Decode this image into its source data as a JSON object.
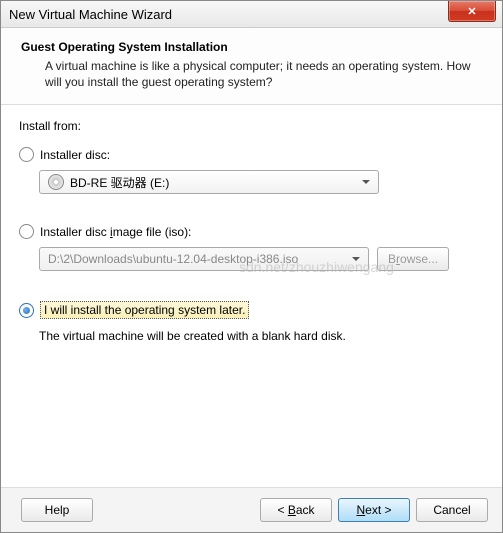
{
  "window": {
    "title": "New Virtual Machine Wizard"
  },
  "header": {
    "title": "Guest Operating System Installation",
    "desc": "A virtual machine is like a physical computer; it needs an operating system. How will you install the guest operating system?"
  },
  "install_from_label": "Install from:",
  "options": {
    "disc": {
      "label": "Installer disc:",
      "dropdown": "BD-RE 驱动器 (E:)"
    },
    "iso": {
      "label": "Installer disc image file (iso):",
      "path": "D:\\2\\Downloads\\ubuntu-12.04-desktop-i386.iso",
      "browse": "Browse..."
    },
    "later": {
      "label": "I will install the operating system later.",
      "note": "The virtual machine will be created with a blank hard disk."
    }
  },
  "footer": {
    "help": "Help",
    "back": "< Back",
    "next": "Next >",
    "cancel": "Cancel"
  },
  "watermark": "sdn.net/zhouzhiwengang"
}
